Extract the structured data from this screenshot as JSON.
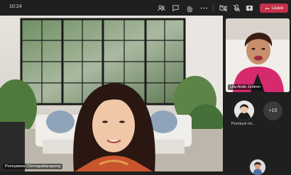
{
  "topbar": {
    "time": "10:24",
    "icons": [
      "participants-icon",
      "chat-icon",
      "raise-hand-icon",
      "rooms-icon",
      "more-icon",
      "camera-off-icon",
      "mic-off-icon",
      "share-icon"
    ],
    "leave_label": "Leave",
    "leave_color": "#c4314b"
  },
  "main_video": {
    "participant_name": "Poonyawee Chinnapattanapong"
  },
  "pip_video": {
    "participant_name": "Lila-Arale Juntren"
  },
  "participants": {
    "avatar_name": "Pornluck Ini...",
    "overflow_count": "+15"
  }
}
